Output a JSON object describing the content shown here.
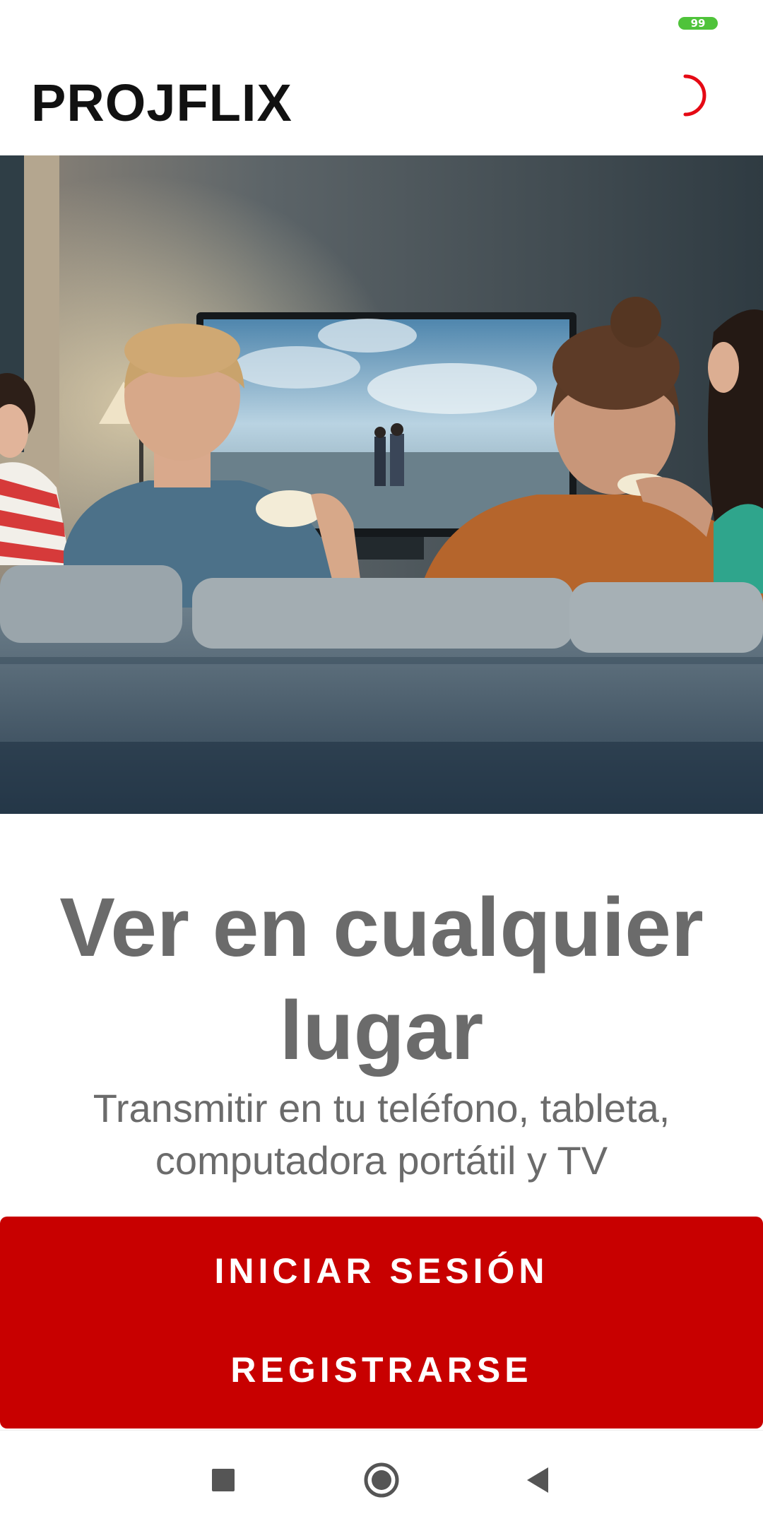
{
  "status_bar": {
    "battery_level": "99",
    "battery_color": "#4fc33a"
  },
  "app_bar": {
    "title": "PROJFLIX",
    "theme_icon": "moon-icon",
    "accent_color": "#e50914"
  },
  "hero": {
    "image": "friends-watching-tv-photo"
  },
  "content": {
    "headline": "Ver en cualquier lugar",
    "subheadline": "Transmitir en tu teléfono, tableta, computadora portátil y TV"
  },
  "actions": {
    "login_label": "INICIAR SESIÓN",
    "register_label": "REGISTRARSE",
    "background_color": "#c80000"
  },
  "nav_bar": {
    "recents_icon": "square-icon",
    "home_icon": "circle-icon",
    "back_icon": "triangle-back-icon"
  }
}
